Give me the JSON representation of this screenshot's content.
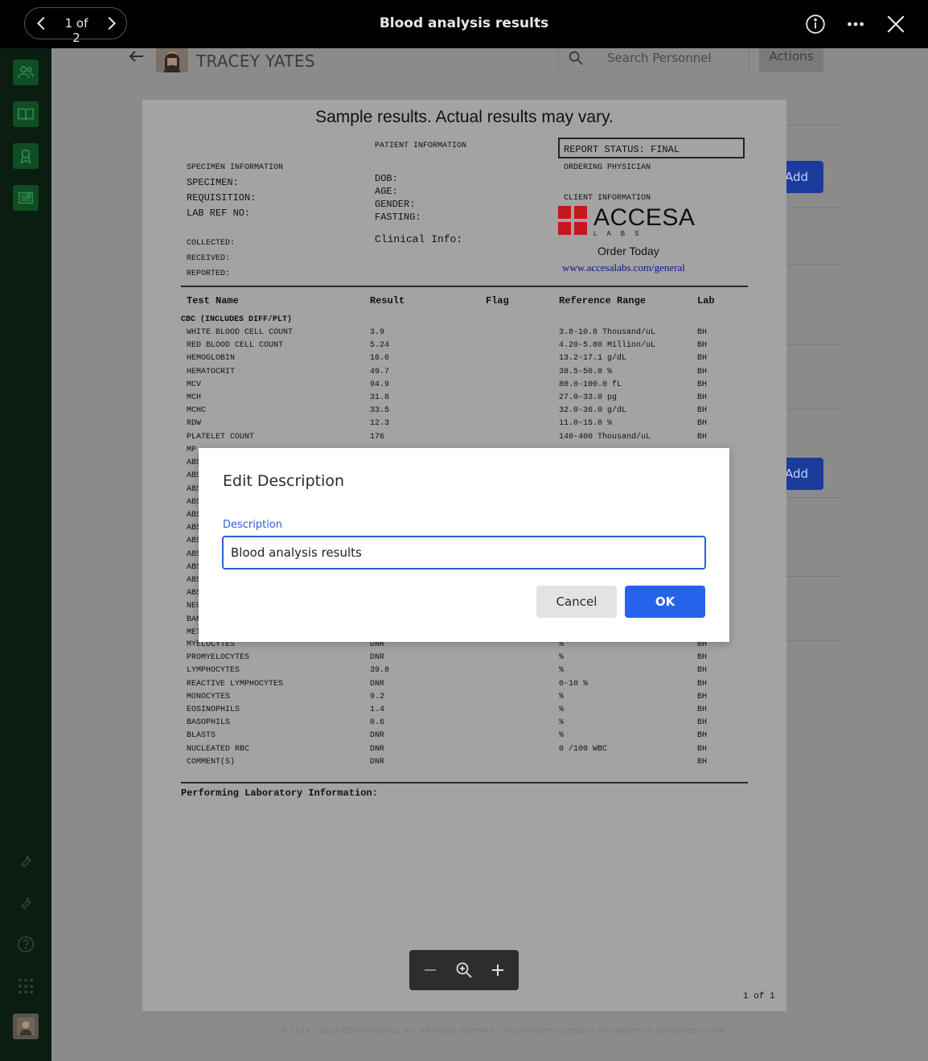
{
  "topbar": {
    "pager_text": "1 of 2",
    "title": "Blood analysis results",
    "icons": [
      "chevron-left-icon",
      "chevron-right-icon",
      "info-icon",
      "more-icon",
      "close-icon"
    ]
  },
  "app": {
    "person_name": "TRACEY YATES",
    "search_placeholder": "Search Personnel",
    "actions_label": "Actions",
    "add_label": "Add",
    "footer": "© 2014 - 2023 ESO Solutions, Inc. All rights reserved · Unauthorized access to this system is prohibited by law",
    "sidebar_icons": [
      "people-icon",
      "book-icon",
      "award-icon",
      "newspaper-icon",
      "wrench-icon",
      "wrench-icon",
      "help-icon",
      "apps-grid-icon",
      "user-avatar"
    ]
  },
  "document": {
    "header": "Sample results. Actual results may vary.",
    "patient_information": "PATIENT INFORMATION",
    "report_status": "REPORT STATUS:  FINAL",
    "ordering_physician": "ORDERING PHYSICIAN",
    "specimen_information": "SPECIMEN INFORMATION",
    "specimen": "SPECIMEN:",
    "requisition": "REQUISITION:",
    "lab_ref_no": "LAB REF NO:",
    "dob": "DOB:",
    "age": "AGE:",
    "gender": "GENDER:",
    "fasting": "FASTING:",
    "client_information": "CLIENT INFORMATION",
    "clinical_info": "Clinical Info:",
    "collected": "COLLECTED:",
    "received": "RECEIVED:",
    "reported": "REPORTED:",
    "logo_word": "ACCESA",
    "logo_sub": "LABS",
    "order_today": "Order Today",
    "url": "www.accesalabs.com/general",
    "columns": [
      "Test Name",
      "Result",
      "Flag",
      "Reference Range",
      "Lab"
    ],
    "section": "CBC (INCLUDES DIFF/PLT)",
    "rows_top": [
      {
        "name": "WHITE BLOOD CELL COUNT",
        "result": "3.9",
        "range": "3.8-10.8 Thousand/uL",
        "lab": "BH"
      },
      {
        "name": "RED BLOOD CELL COUNT",
        "result": "5.24",
        "range": "4.20-5.80 Million/uL",
        "lab": "BH"
      },
      {
        "name": "HEMOGLOBIN",
        "result": "16.6",
        "range": "13.2-17.1 g/dL",
        "lab": "BH"
      },
      {
        "name": "HEMATOCRIT",
        "result": "49.7",
        "range": "38.5-50.0 %",
        "lab": "BH"
      },
      {
        "name": "MCV",
        "result": "94.9",
        "range": "80.0-100.0 fL",
        "lab": "BH"
      },
      {
        "name": "MCH",
        "result": "31.8",
        "range": "27.0-33.0 pg",
        "lab": "BH"
      },
      {
        "name": "MCHC",
        "result": "33.5",
        "range": "32.0-36.0 g/dL",
        "lab": "BH"
      },
      {
        "name": "RDW",
        "result": "12.3",
        "range": "11.0-15.0 %",
        "lab": "BH"
      },
      {
        "name": "PLATELET COUNT",
        "result": "176",
        "range": "140-400 Thousand/uL",
        "lab": "BH"
      }
    ],
    "hidden_prefixes": [
      "MP",
      "ABS",
      "ABS",
      "ABS",
      "ABS",
      "ABS",
      "ABS",
      "ABS",
      "ABS",
      "ABS",
      "ABS",
      "ABS",
      "NEU",
      "BAN",
      "MET"
    ],
    "rows_bottom": [
      {
        "name": "MYELOCYTES",
        "result": "DNR",
        "range": "%",
        "lab": "BH"
      },
      {
        "name": "PROMYELOCYTES",
        "result": "DNR",
        "range": "%",
        "lab": "BH"
      },
      {
        "name": "LYMPHOCYTES",
        "result": "39.8",
        "range": "%",
        "lab": "BH"
      },
      {
        "name": "REACTIVE LYMPHOCYTES",
        "result": "DNR",
        "range": "0-10 %",
        "lab": "BH"
      },
      {
        "name": "MONOCYTES",
        "result": "9.2",
        "range": "%",
        "lab": "BH"
      },
      {
        "name": "EOSINOPHILS",
        "result": "1.4",
        "range": "%",
        "lab": "BH"
      },
      {
        "name": "BASOPHILS",
        "result": "0.6",
        "range": "%",
        "lab": "BH"
      },
      {
        "name": "BLASTS",
        "result": "DNR",
        "range": "%",
        "lab": "BH"
      },
      {
        "name": "NUCLEATED RBC",
        "result": "DNR",
        "range": "0 /100 WBC",
        "lab": "BH"
      },
      {
        "name": "COMMENT(S)",
        "result": "DNR",
        "range": "",
        "lab": "BH"
      }
    ],
    "performing_lab": "Performing Laboratory Information:",
    "page_count": "1 of 1"
  },
  "zoom": {
    "icons": [
      "zoom-out-icon",
      "zoom-fit-icon",
      "zoom-in-icon"
    ]
  },
  "modal": {
    "title": "Edit Description",
    "field_label": "Description",
    "field_value": "Blood analysis results",
    "cancel_label": "Cancel",
    "ok_label": "OK"
  },
  "colors": {
    "primary": "#2563eb",
    "logo_red": "#c6161d",
    "sidebar_green": "#0f4d23"
  }
}
